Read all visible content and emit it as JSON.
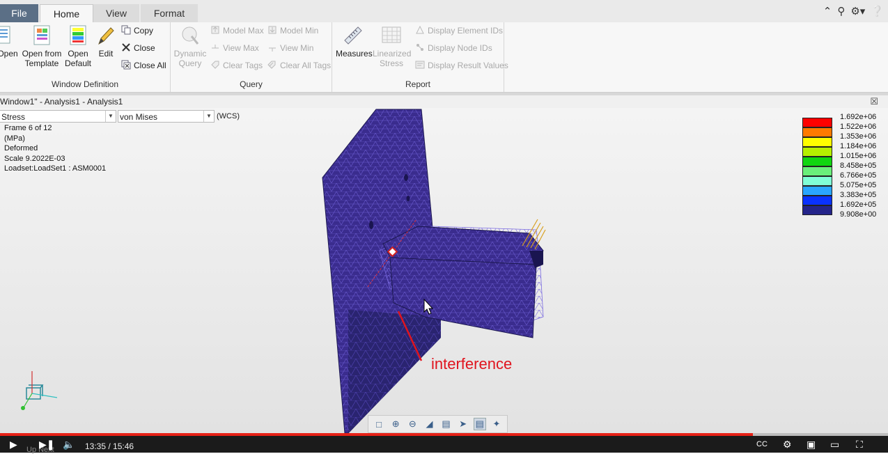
{
  "ribbon_tabs": [
    "File",
    "Home",
    "View",
    "Format"
  ],
  "top_icons": [
    "caret-up-icon",
    "search-icon",
    "settings-icon",
    "help-icon"
  ],
  "groups": {
    "window": {
      "label": "Window Definition",
      "open": "Open",
      "open_template": [
        "Open from",
        "Template"
      ],
      "open_default": [
        "Open",
        "Default"
      ],
      "edit": "Edit",
      "copy": "Copy",
      "close": "Close",
      "close_all": "Close All"
    },
    "query": {
      "label": "Query",
      "dynamic": [
        "Dynamic",
        "Query"
      ],
      "model_max": "Model Max",
      "model_min": "Model Min",
      "view_max": "View Max",
      "view_min": "View Min",
      "clear_tags": "Clear Tags",
      "clear_all_tags": "Clear All Tags"
    },
    "report": {
      "label": "Report",
      "measures": "Measures",
      "linearized": [
        "Linearized",
        "Stress"
      ],
      "element_ids": "Display Element IDs",
      "node_ids": "Display Node IDs",
      "result_values": "Display Result Values"
    }
  },
  "window_title": "Window1\" - Analysis1 - Analysis1",
  "combo_quantity": "Stress",
  "combo_component": "von Mises",
  "coord_system": "(WCS)",
  "info_lines": [
    "Frame 6 of 12",
    "(MPa)",
    "Deformed",
    "Scale  9.2022E-03",
    "Loadset:LoadSet1 :  ASM0001"
  ],
  "legend": [
    {
      "color": "#ff0000",
      "value": "1.692e+06"
    },
    {
      "color": "#ff7a00",
      "value": "1.522e+06"
    },
    {
      "color": "#ffff00",
      "value": "1.353e+06"
    },
    {
      "color": "#b7f000",
      "value": "1.184e+06"
    },
    {
      "color": "#11d611",
      "value": "1.015e+06"
    },
    {
      "color": "#6aef7a",
      "value": "8.458e+05"
    },
    {
      "color": "#80ffd6",
      "value": "6.766e+05"
    },
    {
      "color": "#2aa6ff",
      "value": "5.075e+05"
    },
    {
      "color": "#0a32ff",
      "value": "3.383e+05"
    },
    {
      "color": "#24248a",
      "value": "1.692e+05"
    },
    {
      "color": "",
      "value": "9.908e+00"
    }
  ],
  "annotation": "interference",
  "view_toolbar": [
    "refit-icon",
    "zoom-in-icon",
    "zoom-out-icon",
    "pan-icon",
    "saved-views-icon",
    "spin-icon",
    "display-style-icon",
    "settings-icon"
  ],
  "video": {
    "current": "13:35",
    "duration": "15:46",
    "progress": 0.848,
    "up_next": "Up Next"
  }
}
